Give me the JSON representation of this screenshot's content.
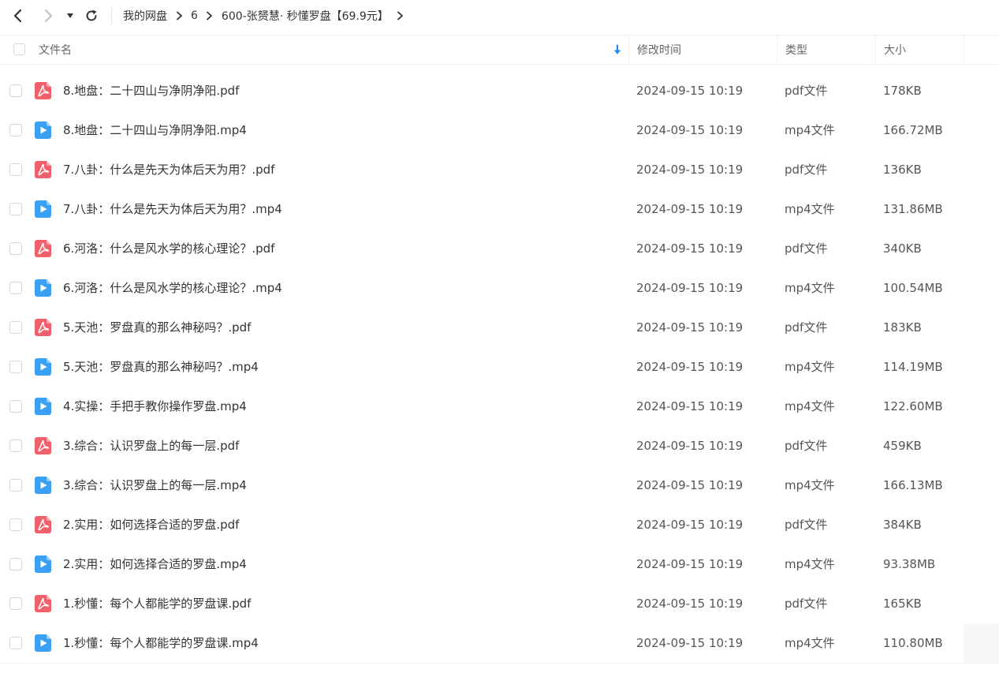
{
  "toolbar": {
    "back_icon": "chevron-left-icon",
    "forward_icon": "chevron-right-icon",
    "dropdown_icon": "caret-down-icon",
    "refresh_icon": "refresh-icon"
  },
  "breadcrumb": {
    "items": [
      "我的网盘",
      "6",
      "600-张赟慧· 秒懂罗盘【69.9元】"
    ]
  },
  "header": {
    "name": "文件名",
    "modified": "修改时间",
    "type": "类型",
    "size": "大小"
  },
  "colors": {
    "pdf_icon": "#f0606a",
    "video_icon": "#3aa0f3",
    "text": "#333333",
    "muted": "#666666",
    "border": "#f0f0f0"
  },
  "files": [
    {
      "name": "8.地盘：二十四山与净阴净阳.pdf",
      "modified": "2024-09-15 10:19",
      "type": "pdf文件",
      "size": "178KB",
      "icon": "pdf-file-icon"
    },
    {
      "name": "8.地盘：二十四山与净阴净阳.mp4",
      "modified": "2024-09-15 10:19",
      "type": "mp4文件",
      "size": "166.72MB",
      "icon": "video-file-icon"
    },
    {
      "name": "7.八卦：什么是先天为体后天为用？.pdf",
      "modified": "2024-09-15 10:19",
      "type": "pdf文件",
      "size": "136KB",
      "icon": "pdf-file-icon"
    },
    {
      "name": "7.八卦：什么是先天为体后天为用？.mp4",
      "modified": "2024-09-15 10:19",
      "type": "mp4文件",
      "size": "131.86MB",
      "icon": "video-file-icon"
    },
    {
      "name": "6.河洛：什么是风水学的核心理论？.pdf",
      "modified": "2024-09-15 10:19",
      "type": "pdf文件",
      "size": "340KB",
      "icon": "pdf-file-icon"
    },
    {
      "name": "6.河洛：什么是风水学的核心理论？.mp4",
      "modified": "2024-09-15 10:19",
      "type": "mp4文件",
      "size": "100.54MB",
      "icon": "video-file-icon"
    },
    {
      "name": "5.天池：罗盘真的那么神秘吗？.pdf",
      "modified": "2024-09-15 10:19",
      "type": "pdf文件",
      "size": "183KB",
      "icon": "pdf-file-icon"
    },
    {
      "name": "5.天池：罗盘真的那么神秘吗？.mp4",
      "modified": "2024-09-15 10:19",
      "type": "mp4文件",
      "size": "114.19MB",
      "icon": "video-file-icon"
    },
    {
      "name": "4.实操：手把手教你操作罗盘.mp4",
      "modified": "2024-09-15 10:19",
      "type": "mp4文件",
      "size": "122.60MB",
      "icon": "video-file-icon"
    },
    {
      "name": "3.综合：认识罗盘上的每一层.pdf",
      "modified": "2024-09-15 10:19",
      "type": "pdf文件",
      "size": "459KB",
      "icon": "pdf-file-icon"
    },
    {
      "name": "3.综合：认识罗盘上的每一层.mp4",
      "modified": "2024-09-15 10:19",
      "type": "mp4文件",
      "size": "166.13MB",
      "icon": "video-file-icon"
    },
    {
      "name": "2.实用：如何选择合适的罗盘.pdf",
      "modified": "2024-09-15 10:19",
      "type": "pdf文件",
      "size": "384KB",
      "icon": "pdf-file-icon"
    },
    {
      "name": "2.实用：如何选择合适的罗盘.mp4",
      "modified": "2024-09-15 10:19",
      "type": "mp4文件",
      "size": "93.38MB",
      "icon": "video-file-icon"
    },
    {
      "name": "1.秒懂：每个人都能学的罗盘课.pdf",
      "modified": "2024-09-15 10:19",
      "type": "pdf文件",
      "size": "165KB",
      "icon": "pdf-file-icon"
    },
    {
      "name": "1.秒懂：每个人都能学的罗盘课.mp4",
      "modified": "2024-09-15 10:19",
      "type": "mp4文件",
      "size": "110.80MB",
      "icon": "video-file-icon"
    }
  ]
}
